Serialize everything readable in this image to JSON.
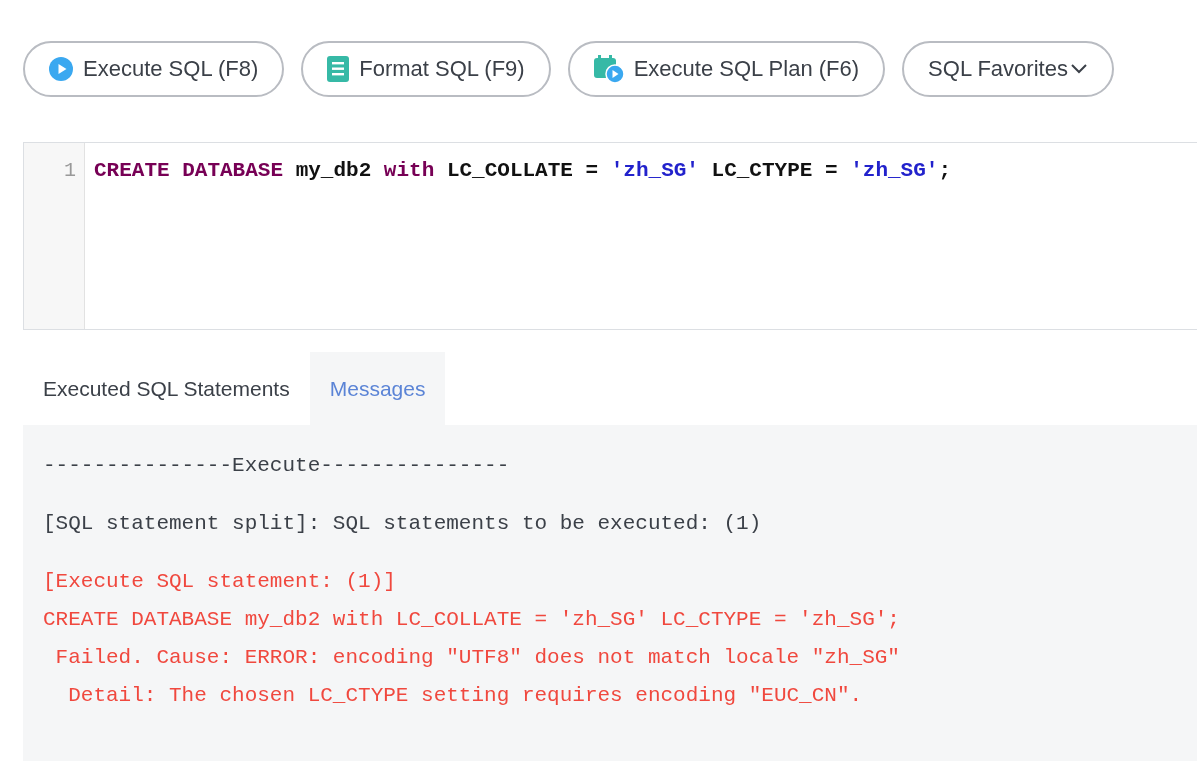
{
  "toolbar": [
    {
      "label": "Execute SQL (F8)",
      "kind": "run"
    },
    {
      "label": "Format SQL (F9)",
      "kind": "format"
    },
    {
      "label": "Execute SQL Plan (F6)",
      "kind": "plan"
    },
    {
      "label": "SQL Favorites",
      "kind": "dropdown"
    }
  ],
  "editor": {
    "lines": [
      {
        "number": "1",
        "tokens": [
          {
            "text": "CREATE DATABASE",
            "kind": "keyword"
          },
          {
            "text": " my_db2 ",
            "kind": "plain"
          },
          {
            "text": "with",
            "kind": "keyword"
          },
          {
            "text": " LC_COLLATE = ",
            "kind": "plain"
          },
          {
            "text": "'zh_SG'",
            "kind": "string"
          },
          {
            "text": " LC_CTYPE = ",
            "kind": "plain"
          },
          {
            "text": "'zh_SG'",
            "kind": "string"
          },
          {
            "text": ";",
            "kind": "plain"
          }
        ]
      }
    ]
  },
  "tabs": [
    {
      "label": "Executed SQL Statements",
      "selected": false
    },
    {
      "label": "Messages",
      "selected": true
    }
  ],
  "messages": [
    {
      "kind": "info",
      "lines": [
        "---------------Execute---------------"
      ]
    },
    {
      "kind": "info",
      "lines": [
        "[SQL statement split]: SQL statements to be executed: (1)"
      ]
    },
    {
      "kind": "error",
      "lines": [
        "[Execute SQL statement: (1)]",
        "CREATE DATABASE my_db2 with LC_COLLATE = 'zh_SG' LC_CTYPE = 'zh_SG';",
        " Failed. Cause: ERROR: encoding \"UTF8\" does not match locale \"zh_SG\"",
        "  Detail: The chosen LC_CTYPE setting requires encoding \"EUC_CN\"."
      ]
    }
  ]
}
